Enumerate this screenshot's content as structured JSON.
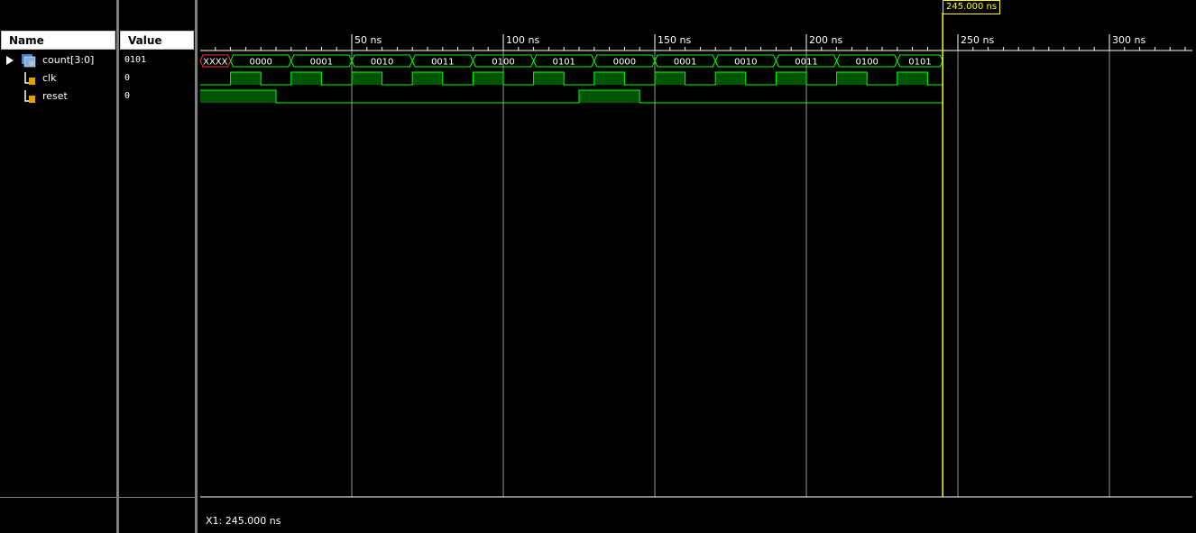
{
  "columns": {
    "name_header": "Name",
    "value_header": "Value"
  },
  "signals": [
    {
      "name": "count[3:0]",
      "value": "0101",
      "icon": "bus-icon",
      "expandable": true
    },
    {
      "name": "clk",
      "value": "0",
      "icon": "signal-icon",
      "expandable": false
    },
    {
      "name": "reset",
      "value": "0",
      "icon": "signal-icon",
      "expandable": false
    }
  ],
  "timeline": {
    "unit": "ns",
    "tick_labels": [
      "50 ns",
      "100 ns",
      "150 ns",
      "200 ns",
      "250 ns",
      "300 ns"
    ],
    "tick_values": [
      50,
      100,
      150,
      200,
      250,
      300
    ],
    "visible_range": [
      0,
      327
    ],
    "sim_end": 245
  },
  "cursor": {
    "label": "245.000 ns",
    "time": 245
  },
  "status": {
    "text": "X1: 245.000 ns"
  },
  "colors": {
    "wave": "#00ff00",
    "wave_fill": "#005500",
    "unknown": "#ff3333",
    "cursor": "#ffff00",
    "grid": "#c0c0c0"
  },
  "waves": {
    "count": {
      "segments": [
        {
          "from": 0,
          "to": 10,
          "label": "XXXX",
          "unknown": true
        },
        {
          "from": 10,
          "to": 30,
          "label": "0000"
        },
        {
          "from": 30,
          "to": 50,
          "label": "0001"
        },
        {
          "from": 50,
          "to": 70,
          "label": "0010"
        },
        {
          "from": 70,
          "to": 90,
          "label": "0011"
        },
        {
          "from": 90,
          "to": 110,
          "label": "0100"
        },
        {
          "from": 110,
          "to": 130,
          "label": "0101"
        },
        {
          "from": 130,
          "to": 150,
          "label": "0000"
        },
        {
          "from": 150,
          "to": 170,
          "label": "0001"
        },
        {
          "from": 170,
          "to": 190,
          "label": "0010"
        },
        {
          "from": 190,
          "to": 210,
          "label": "0011"
        },
        {
          "from": 210,
          "to": 230,
          "label": "0100"
        },
        {
          "from": 230,
          "to": 245,
          "label": "0101"
        }
      ]
    },
    "clk": {
      "high": [
        [
          10,
          20
        ],
        [
          30,
          40
        ],
        [
          50,
          60
        ],
        [
          70,
          80
        ],
        [
          90,
          100
        ],
        [
          110,
          120
        ],
        [
          130,
          140
        ],
        [
          150,
          160
        ],
        [
          170,
          180
        ],
        [
          190,
          200
        ],
        [
          210,
          220
        ],
        [
          230,
          240
        ]
      ]
    },
    "reset": {
      "high": [
        [
          0,
          25
        ],
        [
          125,
          145
        ]
      ]
    }
  }
}
